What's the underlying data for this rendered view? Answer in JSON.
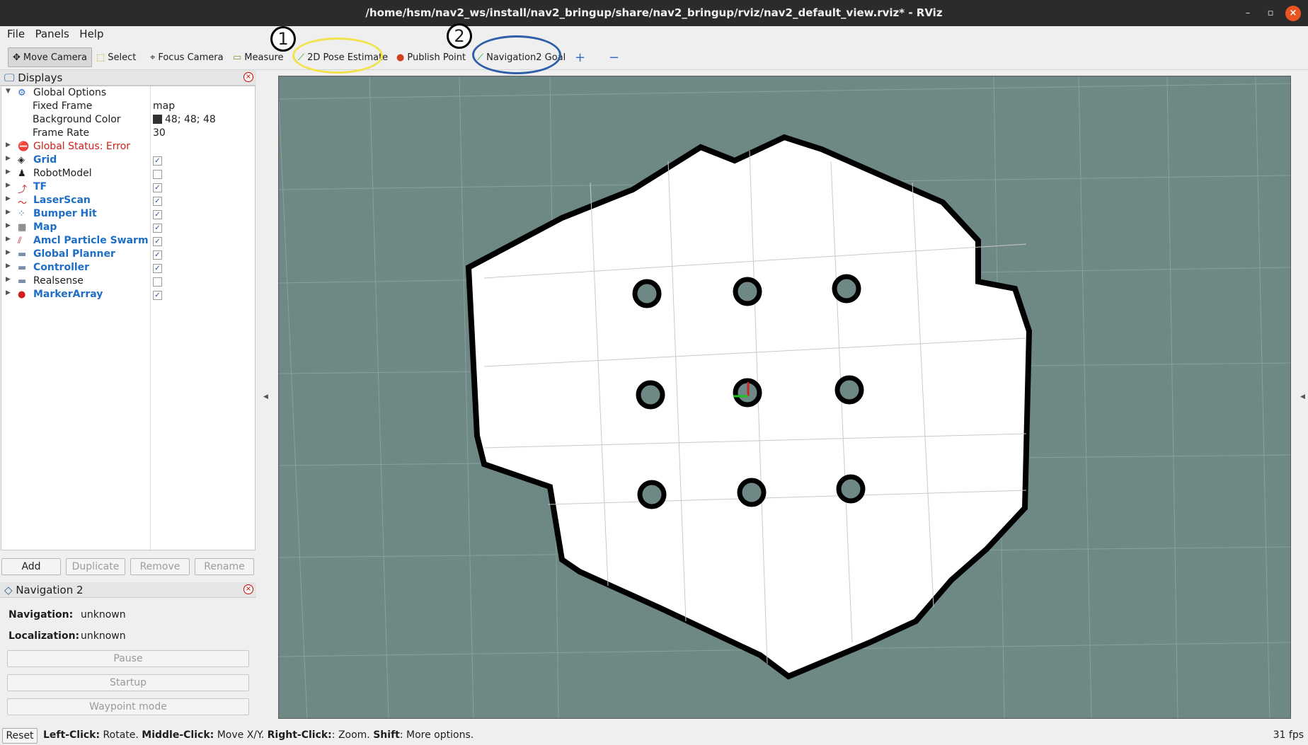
{
  "window": {
    "title": "/home/hsm/nav2_ws/install/nav2_bringup/share/nav2_bringup/rviz/nav2_default_view.rviz* - RViz",
    "minimize": "–",
    "maximize": "▫",
    "close": "×"
  },
  "menu": [
    "File",
    "Panels",
    "Help"
  ],
  "toolbar": {
    "tools": [
      {
        "label": "Move Camera",
        "icon": "move-camera-icon",
        "glyph": "✥",
        "active": true
      },
      {
        "label": "Select",
        "icon": "select-icon",
        "glyph": "⬚"
      },
      {
        "label": "Focus Camera",
        "icon": "focus-camera-icon",
        "glyph": "⌖"
      },
      {
        "label": "Measure",
        "icon": "measure-icon",
        "glyph": "▭"
      },
      {
        "label": "2D Pose Estimate",
        "icon": "pose-estimate-icon",
        "glyph": "⟋"
      },
      {
        "label": "Publish Point",
        "icon": "publish-point-icon",
        "glyph": "📍"
      },
      {
        "label": "Navigation2 Goal",
        "icon": "nav-goal-icon",
        "glyph": "⟋"
      }
    ],
    "add_tool": "+",
    "remove_tool": "−",
    "annotations": [
      {
        "number": "1",
        "color": "#f2e24b"
      },
      {
        "number": "2",
        "color": "#2f5fa8"
      }
    ]
  },
  "displays": {
    "title": "Displays",
    "global_options": {
      "label": "Global Options",
      "props": [
        {
          "name": "Fixed Frame",
          "value": "map"
        },
        {
          "name": "Background Color",
          "value": "48; 48; 48",
          "swatch": "#303030"
        },
        {
          "name": "Frame Rate",
          "value": "30"
        }
      ]
    },
    "items": [
      {
        "label": "Global Status: Error",
        "style": "red",
        "icon": "error-icon",
        "glyph": "⛔",
        "checkbox": null
      },
      {
        "label": "Grid",
        "style": "blue",
        "icon": "grid-icon",
        "glyph": "◈",
        "checked": true
      },
      {
        "label": "RobotModel",
        "style": "plain",
        "icon": "robot-model-icon",
        "glyph": "♟",
        "checked": false
      },
      {
        "label": "TF",
        "style": "blue",
        "icon": "tf-icon",
        "glyph": "⤴",
        "checked": true
      },
      {
        "label": "LaserScan",
        "style": "blue",
        "icon": "laserscan-icon",
        "glyph": "〜",
        "checked": true
      },
      {
        "label": "Bumper Hit",
        "style": "blue",
        "icon": "bumper-hit-icon",
        "glyph": "⁘",
        "checked": true
      },
      {
        "label": "Map",
        "style": "blue",
        "icon": "map-icon",
        "glyph": "▦",
        "checked": true
      },
      {
        "label": "Amcl Particle Swarm",
        "style": "blue",
        "icon": "particle-swarm-icon",
        "glyph": "⫽",
        "checked": true
      },
      {
        "label": "Global Planner",
        "style": "blue",
        "icon": "folder-icon",
        "glyph": "🗀",
        "checked": true
      },
      {
        "label": "Controller",
        "style": "blue",
        "icon": "folder-icon",
        "glyph": "🗀",
        "checked": true
      },
      {
        "label": "Realsense",
        "style": "plain",
        "icon": "folder-icon",
        "glyph": "🗀",
        "checked": false
      },
      {
        "label": "MarkerArray",
        "style": "blue",
        "icon": "marker-array-icon",
        "glyph": "●",
        "checked": true
      }
    ],
    "buttons": {
      "add": "Add",
      "duplicate": "Duplicate",
      "remove": "Remove",
      "rename": "Rename"
    }
  },
  "navigation2": {
    "title": "Navigation 2",
    "navigation_label": "Navigation:",
    "navigation_value": "unknown",
    "localization_label": "Localization:",
    "localization_value": "unknown",
    "pause": "Pause",
    "startup": "Startup",
    "waypoint": "Waypoint mode"
  },
  "status": {
    "reset": "Reset",
    "hint_parts": [
      {
        "text": "Left-Click:",
        "bold": true
      },
      {
        "text": " Rotate. ",
        "bold": false
      },
      {
        "text": "Middle-Click:",
        "bold": true
      },
      {
        "text": " Move X/Y. ",
        "bold": false
      },
      {
        "text": "Right-Click:",
        "bold": true
      },
      {
        "text": ": Zoom. ",
        "bold": false
      },
      {
        "text": "Shift",
        "bold": true
      },
      {
        "text": ": More options.",
        "bold": false
      }
    ],
    "fps": "31 fps"
  },
  "colors": {
    "viewport_bg": "#6e8885",
    "map_free": "#ffffff",
    "map_wall": "#000000",
    "grid_line": "#8aa09d"
  }
}
